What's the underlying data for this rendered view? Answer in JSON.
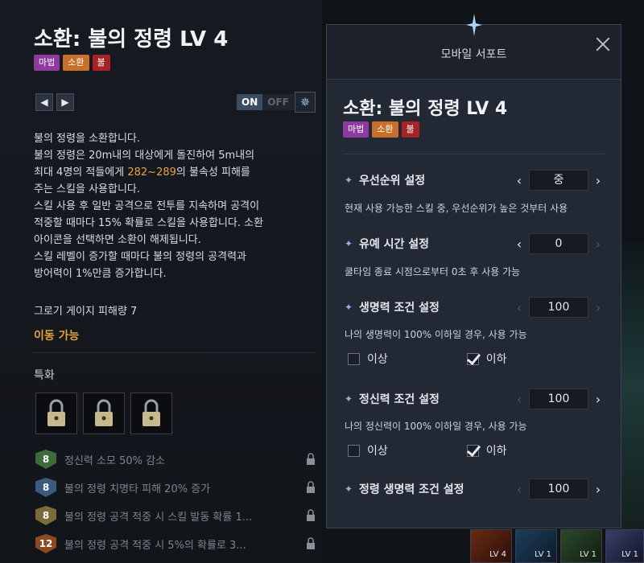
{
  "left": {
    "skill_title": "소환: 불의 정령 LV 4",
    "tags": [
      {
        "label": "마법",
        "color": "#8e3a9e"
      },
      {
        "label": "소환",
        "color": "#c8702a"
      },
      {
        "label": "불",
        "color": "#a82424"
      }
    ],
    "toggle_on": "ON",
    "toggle_off": "OFF",
    "desc_line1": "불의 정령을 소환합니다.",
    "desc_line2": "불의 정령은 20m내의 대상에게 돌진하여 5m내의",
    "desc_line3a": "최대 4명의 적들에게 ",
    "desc_damage": "282~289",
    "desc_line3b": "의 불속성 피해를",
    "desc_line4": "주는 스킬을 사용합니다.",
    "desc_line5": "스킬 사용 후 일반 공격으로 전투를 지속하며 공격이",
    "desc_line6": "적중할 때마다 15% 확률로 스킬을 사용합니다. 소환",
    "desc_line7": "아이콘을 선택하면 소환이 해제됩니다.",
    "desc_line8": "스킬 레벨이 증가할 때마다 불의 정령의 공격력과",
    "desc_line9": "방어력이 1%만큼 증가합니다.",
    "groggy": "그로기 게이지 피해량 7",
    "movable": "이동 가능",
    "spec_title": "특화",
    "spec_items": [
      {
        "level": "8",
        "text": "정신력 소모 50% 감소",
        "color": "#3d6b3a"
      },
      {
        "level": "8",
        "text": "불의 정령 치명타 피해 20% 증가",
        "color": "#3c5a80"
      },
      {
        "level": "8",
        "text": "불의 정령 공격 적중 시 스킬 발동 확률 1...",
        "color": "#7a6a3c"
      },
      {
        "level": "12",
        "text": "불의 정령 공격 적중 시 5%의 확률로 3...",
        "color": "#8a4a22"
      }
    ]
  },
  "panel": {
    "title": "모바일 서포트",
    "skill_title": "소환: 불의 정령 LV 4",
    "tags": [
      {
        "label": "마법",
        "color": "#8e3a9e"
      },
      {
        "label": "소환",
        "color": "#c8702a"
      },
      {
        "label": "불",
        "color": "#a82424"
      }
    ],
    "priority_label": "우선순위 설정",
    "priority_value": "중",
    "priority_desc": "현재 사용 가능한 스킬 중, 우선순위가 높은 것부터 사용",
    "delay_label": "유예 시간 설정",
    "delay_value": "0",
    "delay_desc": "쿨타임 종료 시점으로부터 0초 후 사용 가능",
    "hp_label": "생명력 조건 설정",
    "hp_value": "100",
    "hp_desc": "나의 생명력이 100% 이하일 경우, 사용 가능",
    "hp_above": "이상",
    "hp_below": "이하",
    "mp_label": "정신력 조건 설정",
    "mp_value": "100",
    "mp_desc": "나의 정신력이 100% 이하일 경우, 사용 가능",
    "mp_above": "이상",
    "mp_below": "이하",
    "spirit_hp_label": "정령 생명력 조건 설정",
    "spirit_hp_value": "100"
  },
  "bar": {
    "icon1_lv": "LV 4",
    "icon2_lv": "LV 1",
    "icon3_lv": "LV 1",
    "icon4_lv": "LV 1"
  }
}
